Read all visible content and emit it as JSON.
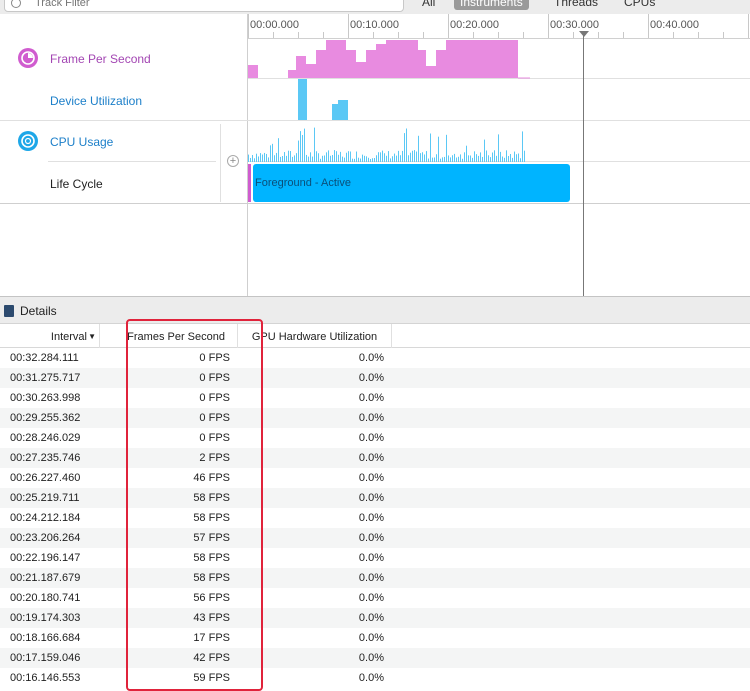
{
  "toolbar": {
    "filter_placeholder": "Track Filter",
    "tabs": [
      "All",
      "Instruments",
      "Threads",
      "CPUs"
    ],
    "active_tab": "Instruments"
  },
  "timeline": {
    "ticks": [
      "00:00.000",
      "00:10.000",
      "00:20.000",
      "00:30.000",
      "00:40.000"
    ],
    "tracks": {
      "fps": "Frame Per Second",
      "device": "Device Utilization",
      "cpu": "CPU Usage",
      "lifecycle": "Life Cycle"
    },
    "lifecycle_state": "Foreground - Active",
    "colors": {
      "fps": "#e88be0",
      "device": "#5bc8f5",
      "cpu": "#5bc8f5",
      "lifecycle": "#00b4ff"
    }
  },
  "details": {
    "title": "Details",
    "columns": {
      "interval": "Interval",
      "fps": "Frames Per Second",
      "gpu": "GPU Hardware Utilization"
    },
    "rows": [
      {
        "interval": "00:32.284.111",
        "fps": "0 FPS",
        "gpu": "0.0%"
      },
      {
        "interval": "00:31.275.717",
        "fps": "0 FPS",
        "gpu": "0.0%"
      },
      {
        "interval": "00:30.263.998",
        "fps": "0 FPS",
        "gpu": "0.0%"
      },
      {
        "interval": "00:29.255.362",
        "fps": "0 FPS",
        "gpu": "0.0%"
      },
      {
        "interval": "00:28.246.029",
        "fps": "0 FPS",
        "gpu": "0.0%"
      },
      {
        "interval": "00:27.235.746",
        "fps": "2 FPS",
        "gpu": "0.0%"
      },
      {
        "interval": "00:26.227.460",
        "fps": "46 FPS",
        "gpu": "0.0%"
      },
      {
        "interval": "00:25.219.711",
        "fps": "58 FPS",
        "gpu": "0.0%"
      },
      {
        "interval": "00:24.212.184",
        "fps": "58 FPS",
        "gpu": "0.0%"
      },
      {
        "interval": "00:23.206.264",
        "fps": "57 FPS",
        "gpu": "0.0%"
      },
      {
        "interval": "00:22.196.147",
        "fps": "58 FPS",
        "gpu": "0.0%"
      },
      {
        "interval": "00:21.187.679",
        "fps": "58 FPS",
        "gpu": "0.0%"
      },
      {
        "interval": "00:20.180.741",
        "fps": "56 FPS",
        "gpu": "0.0%"
      },
      {
        "interval": "00:19.174.303",
        "fps": "43 FPS",
        "gpu": "0.0%"
      },
      {
        "interval": "00:18.166.684",
        "fps": "17 FPS",
        "gpu": "0.0%"
      },
      {
        "interval": "00:17.159.046",
        "fps": "42 FPS",
        "gpu": "0.0%"
      },
      {
        "interval": "00:16.146.553",
        "fps": "59 FPS",
        "gpu": "0.0%"
      }
    ]
  }
}
